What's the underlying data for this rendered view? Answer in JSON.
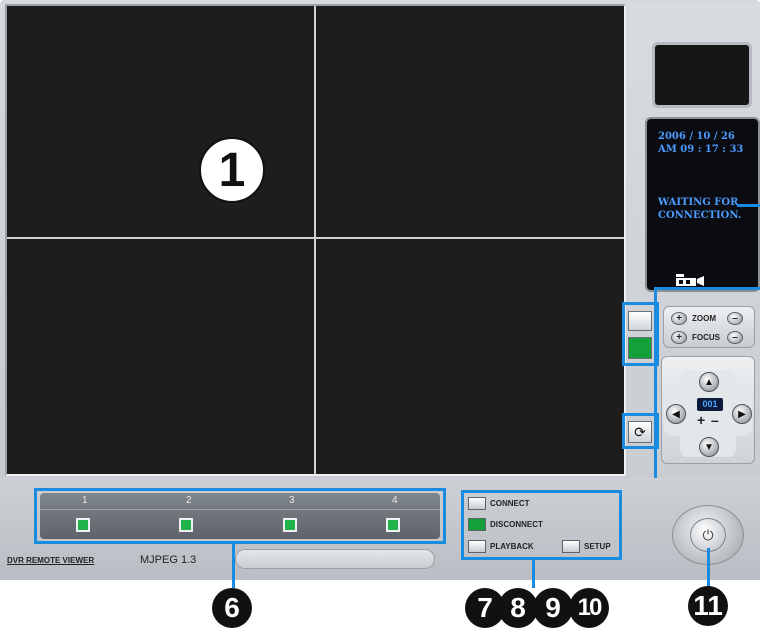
{
  "app": {
    "name": "DVR REMOTE VIEWER",
    "codec": "MJPEG 1.3"
  },
  "video": {
    "callout": "1"
  },
  "info": {
    "date": "2006 / 10 / 26",
    "time": "AM 09 : 17 : 33",
    "message": "WAITING FOR CONNECTION."
  },
  "ptz": {
    "zoom_label": "ZOOM",
    "focus_label": "FOCUS",
    "preset": "001"
  },
  "channels": [
    {
      "num": "1"
    },
    {
      "num": "2"
    },
    {
      "num": "3"
    },
    {
      "num": "4"
    }
  ],
  "actions": {
    "connect": "CONNECT",
    "disconnect": "DISCONNECT",
    "playback": "PLAYBACK",
    "setup": "SETUP"
  },
  "callouts": {
    "n6": "6",
    "n7": "7",
    "n8": "8",
    "n9": "9",
    "n10": "10",
    "n11": "11"
  },
  "colors": {
    "accent": "#1a8be0",
    "led": "#22b34a",
    "screen_text": "#4a9cff"
  }
}
